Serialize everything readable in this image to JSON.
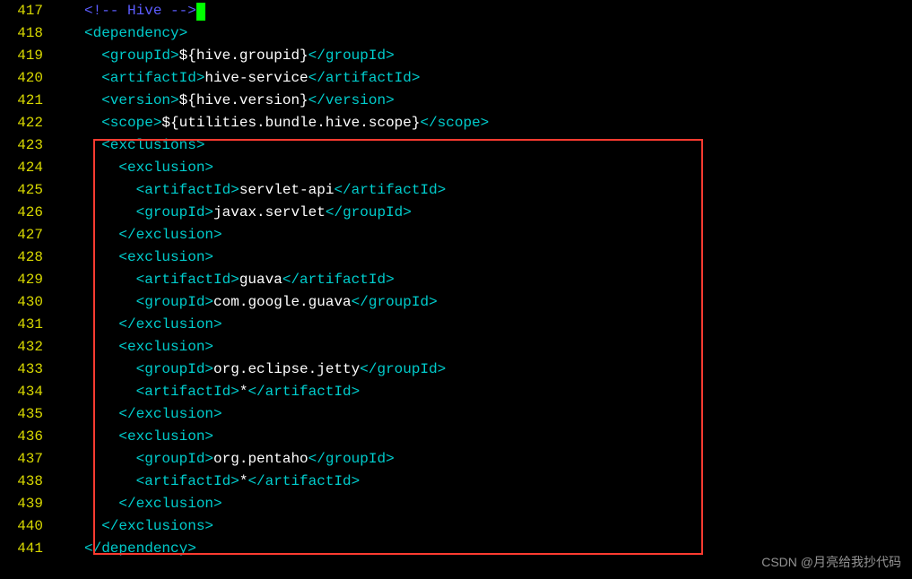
{
  "watermark": "CSDN @月亮给我抄代码",
  "lines": [
    {
      "num": "417",
      "indent": "",
      "tokens": [
        {
          "cls": "comment",
          "text": "<!-- Hive -->"
        },
        {
          "cls": "cursor",
          "text": " "
        }
      ]
    },
    {
      "num": "418",
      "indent": "",
      "tokens": [
        {
          "cls": "tag",
          "text": "<dependency>"
        }
      ]
    },
    {
      "num": "419",
      "indent": "  ",
      "tokens": [
        {
          "cls": "tag",
          "text": "<groupId>"
        },
        {
          "cls": "txt",
          "text": "${hive.groupid}"
        },
        {
          "cls": "tag",
          "text": "</groupId>"
        }
      ]
    },
    {
      "num": "420",
      "indent": "  ",
      "tokens": [
        {
          "cls": "tag",
          "text": "<artifactId>"
        },
        {
          "cls": "txt",
          "text": "hive-service"
        },
        {
          "cls": "tag",
          "text": "</artifactId>"
        }
      ]
    },
    {
      "num": "421",
      "indent": "  ",
      "tokens": [
        {
          "cls": "tag",
          "text": "<version>"
        },
        {
          "cls": "txt",
          "text": "${hive.version}"
        },
        {
          "cls": "tag",
          "text": "</version>"
        }
      ]
    },
    {
      "num": "422",
      "indent": "  ",
      "tokens": [
        {
          "cls": "tag",
          "text": "<scope>"
        },
        {
          "cls": "txt",
          "text": "${utilities.bundle.hive.scope}"
        },
        {
          "cls": "tag",
          "text": "</scope>"
        }
      ]
    },
    {
      "num": "423",
      "indent": "  ",
      "tokens": [
        {
          "cls": "tag",
          "text": "<exclusions>"
        }
      ]
    },
    {
      "num": "424",
      "indent": "    ",
      "tokens": [
        {
          "cls": "tag",
          "text": "<exclusion>"
        }
      ]
    },
    {
      "num": "425",
      "indent": "      ",
      "tokens": [
        {
          "cls": "tag",
          "text": "<artifactId>"
        },
        {
          "cls": "txt",
          "text": "servlet-api"
        },
        {
          "cls": "tag",
          "text": "</artifactId>"
        }
      ]
    },
    {
      "num": "426",
      "indent": "      ",
      "tokens": [
        {
          "cls": "tag",
          "text": "<groupId>"
        },
        {
          "cls": "txt",
          "text": "javax.servlet"
        },
        {
          "cls": "tag",
          "text": "</groupId>"
        }
      ]
    },
    {
      "num": "427",
      "indent": "    ",
      "tokens": [
        {
          "cls": "tag",
          "text": "</exclusion>"
        }
      ]
    },
    {
      "num": "428",
      "indent": "    ",
      "tokens": [
        {
          "cls": "tag",
          "text": "<exclusion>"
        }
      ]
    },
    {
      "num": "429",
      "indent": "      ",
      "tokens": [
        {
          "cls": "tag",
          "text": "<artifactId>"
        },
        {
          "cls": "txt",
          "text": "guava"
        },
        {
          "cls": "tag",
          "text": "</artifactId>"
        }
      ]
    },
    {
      "num": "430",
      "indent": "      ",
      "tokens": [
        {
          "cls": "tag",
          "text": "<groupId>"
        },
        {
          "cls": "txt",
          "text": "com.google.guava"
        },
        {
          "cls": "tag",
          "text": "</groupId>"
        }
      ]
    },
    {
      "num": "431",
      "indent": "    ",
      "tokens": [
        {
          "cls": "tag",
          "text": "</exclusion>"
        }
      ]
    },
    {
      "num": "432",
      "indent": "    ",
      "tokens": [
        {
          "cls": "tag",
          "text": "<exclusion>"
        }
      ]
    },
    {
      "num": "433",
      "indent": "      ",
      "tokens": [
        {
          "cls": "tag",
          "text": "<groupId>"
        },
        {
          "cls": "txt",
          "text": "org.eclipse.jetty"
        },
        {
          "cls": "tag",
          "text": "</groupId>"
        }
      ]
    },
    {
      "num": "434",
      "indent": "      ",
      "tokens": [
        {
          "cls": "tag",
          "text": "<artifactId>"
        },
        {
          "cls": "txt",
          "text": "*"
        },
        {
          "cls": "tag",
          "text": "</artifactId>"
        }
      ]
    },
    {
      "num": "435",
      "indent": "    ",
      "tokens": [
        {
          "cls": "tag",
          "text": "</exclusion>"
        }
      ]
    },
    {
      "num": "436",
      "indent": "    ",
      "tokens": [
        {
          "cls": "tag",
          "text": "<exclusion>"
        }
      ]
    },
    {
      "num": "437",
      "indent": "      ",
      "tokens": [
        {
          "cls": "tag",
          "text": "<groupId>"
        },
        {
          "cls": "txt",
          "text": "org.pentaho"
        },
        {
          "cls": "tag",
          "text": "</groupId>"
        }
      ]
    },
    {
      "num": "438",
      "indent": "      ",
      "tokens": [
        {
          "cls": "tag",
          "text": "<artifactId>"
        },
        {
          "cls": "txt",
          "text": "*"
        },
        {
          "cls": "tag",
          "text": "</artifactId>"
        }
      ]
    },
    {
      "num": "439",
      "indent": "    ",
      "tokens": [
        {
          "cls": "tag",
          "text": "</exclusion>"
        }
      ]
    },
    {
      "num": "440",
      "indent": "  ",
      "tokens": [
        {
          "cls": "tag",
          "text": "</exclusions>"
        }
      ]
    },
    {
      "num": "441",
      "indent": "",
      "tokens": [
        {
          "cls": "tag",
          "text": "</dependency>"
        }
      ]
    }
  ]
}
